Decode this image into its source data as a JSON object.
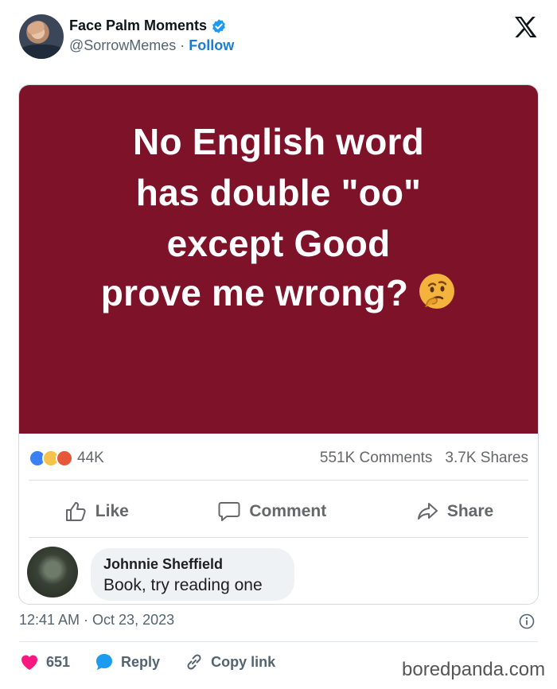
{
  "header": {
    "display_name": "Face Palm Moments",
    "handle": "@SorrowMemes",
    "separator": " · ",
    "follow_label": "Follow",
    "verified_icon": "verified-badge-icon",
    "platform_icon": "x-logo-icon"
  },
  "meme": {
    "lines": [
      "No English word",
      "has double \"oo\"",
      "except Good",
      "prove me wrong?"
    ],
    "emoji": "thinking-face-icon",
    "background_color": "#7e1228"
  },
  "facebook": {
    "reaction_icons": [
      "like-reaction-icon",
      "haha-reaction-icon",
      "angry-reaction-icon"
    ],
    "reaction_count": "44K",
    "comments_count": "551K Comments",
    "shares_count": "3.7K Shares",
    "actions": [
      {
        "label": "Like",
        "icon": "thumbs-up-icon"
      },
      {
        "label": "Comment",
        "icon": "comment-icon"
      },
      {
        "label": "Share",
        "icon": "share-icon"
      }
    ],
    "comment": {
      "author": "Johnnie Sheffield",
      "text": "Book, try reading one"
    }
  },
  "post": {
    "timestamp": "12:41 AM · Oct 23, 2023"
  },
  "footer": {
    "like_count": "651",
    "reply_label": "Reply",
    "copy_label": "Copy link"
  },
  "watermark": "boredpanda.com",
  "colors": {
    "accent": "#1d7bd6",
    "heart": "#f91880",
    "reply_bubble": "#1d9bf0"
  }
}
